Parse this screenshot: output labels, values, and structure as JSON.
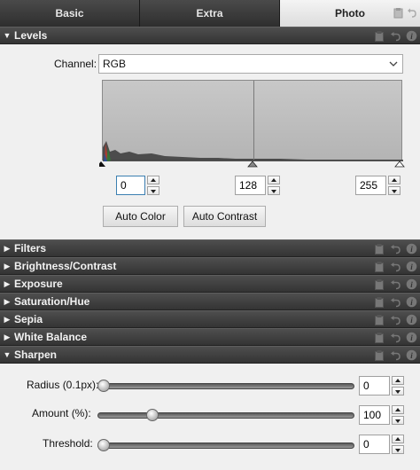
{
  "tabs": [
    {
      "label": "Basic"
    },
    {
      "label": "Extra"
    },
    {
      "label": "Photo"
    }
  ],
  "levels": {
    "title": "Levels",
    "channel_label": "Channel:",
    "channel_value": "RGB",
    "input_black": "0",
    "input_mid": "128",
    "input_white": "255",
    "auto_color": "Auto Color",
    "auto_contrast": "Auto Contrast"
  },
  "sections": [
    {
      "label": "Filters"
    },
    {
      "label": "Brightness/Contrast"
    },
    {
      "label": "Exposure"
    },
    {
      "label": "Saturation/Hue"
    },
    {
      "label": "Sepia"
    },
    {
      "label": "White Balance"
    }
  ],
  "sharpen": {
    "title": "Sharpen",
    "radius_label": "Radius (0.1px):",
    "radius_value": "0",
    "amount_label": "Amount (%):",
    "amount_value": "100",
    "threshold_label": "Threshold:",
    "threshold_value": "0"
  },
  "colors": {
    "bar_dark": "#3a3a3a",
    "panel_bg": "#f0f0f0",
    "active_tab": "#e8e8e8"
  }
}
